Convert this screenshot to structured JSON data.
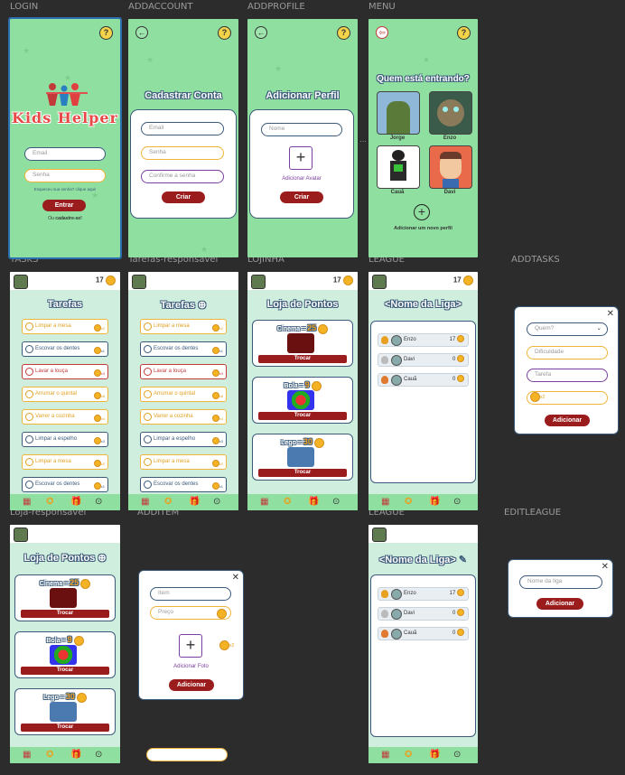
{
  "frames": {
    "login": "LOGIN",
    "addaccount": "ADDACCOUNT",
    "addprofile": "ADDPROFILE",
    "menu": "MENU",
    "tasks": "TASKS",
    "tarefas_resp": "Tarefas-responsavel",
    "lojinha": "LOJINHA",
    "league": "LEAGUE",
    "addtasks": "ADDTASKS",
    "loja_resp": "Loja-responsavel",
    "additem": "ADDITEM",
    "league2": "LEAGUE",
    "editleague": "EDITLEAGUE"
  },
  "login": {
    "logo": "Kids Helper",
    "email_placeholder": "Email",
    "password_placeholder": "Senha",
    "forgot": "Esqueceu sua senha? clique aqui!",
    "enter": "Entrar",
    "register_prefix": "Ou",
    "register_link": "cadastre-se!"
  },
  "addaccount": {
    "title": "Cadastrar Conta",
    "email": "Email",
    "password": "Senha",
    "confirm": "Confirme a senha",
    "create": "Criar"
  },
  "addprofile": {
    "title": "Adicionar Perfil",
    "name": "Nome",
    "add_avatar": "Adicionar Avatar",
    "create": "Criar"
  },
  "menu": {
    "title": "Quem está entrando?",
    "profiles": [
      "Jorge",
      "Enzo",
      "Cauã",
      "Davi"
    ],
    "add_profile": "Adicionar um novo perfil"
  },
  "points": "17",
  "tasks": {
    "title": "Tarefas",
    "title_resp": "Tarefas ⊕",
    "items": [
      {
        "label": "Limpar a mesa",
        "reward": "x2",
        "kind": "o"
      },
      {
        "label": "Escovar os dentes",
        "reward": "x1",
        "kind": "b"
      },
      {
        "label": "Lavar a louça",
        "reward": "x3",
        "kind": "r"
      },
      {
        "label": "Arrumar o quintal",
        "reward": "x8",
        "kind": "o"
      },
      {
        "label": "Varrer a cozinha",
        "reward": "x4",
        "kind": "o"
      },
      {
        "label": "Limpar a espelho",
        "reward": "x3",
        "kind": "b"
      },
      {
        "label": "Limpar a mesa",
        "reward": "x2",
        "kind": "o"
      },
      {
        "label": "Escovar os dentes",
        "reward": "x1",
        "kind": "b"
      }
    ]
  },
  "store": {
    "title": "Loja de Pontos",
    "title_resp": "Loja de Pontos ⊕",
    "items": [
      {
        "name": "Cinema",
        "eq": "=",
        "price": "25"
      },
      {
        "name": "Bola",
        "eq": "=",
        "price": "9"
      },
      {
        "name": "Lego",
        "eq": "=",
        "price": "30"
      }
    ],
    "trade": "Trocar"
  },
  "league": {
    "title": "<Nome da Liga>",
    "rows": [
      {
        "name": "Enzo",
        "points": "17",
        "medal": "#e8a020"
      },
      {
        "name": "Davi",
        "points": "0",
        "medal": "#bbbbbb"
      },
      {
        "name": "Cauã",
        "points": "0",
        "medal": "#e07a30"
      }
    ]
  },
  "addtasks": {
    "who": "Quem?",
    "difficulty": "Dificuldade",
    "task": "Tarefa",
    "reward": "x2",
    "add": "Adicionar"
  },
  "additem": {
    "item": "Item",
    "price": "Preço",
    "add_photo": "Adicionar Foto",
    "reward": "x2",
    "add": "Adicionar"
  },
  "editleague": {
    "name_placeholder": "Nome da liga",
    "add": "Adicionar"
  },
  "colors": {
    "bg": "#2c2c2c",
    "green": "#8fe0a0",
    "mint": "#cfeedd",
    "dark_red": "#9b1c1c",
    "navy": "#3b5a7a",
    "coin": "#f3b324"
  }
}
